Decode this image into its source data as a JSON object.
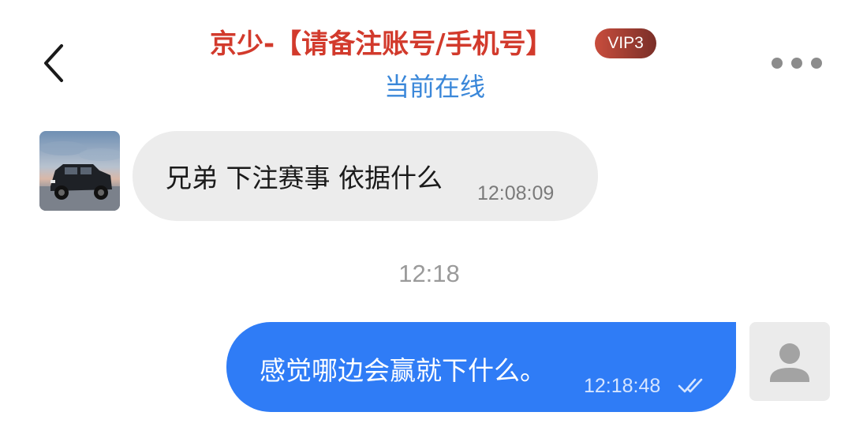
{
  "header": {
    "title": "京少-【请备注账号/手机号】",
    "vip_badge": "VIP3",
    "status": "当前在线"
  },
  "icons": {
    "back": "back-chevron-icon",
    "more": "more-dots-icon",
    "read_receipt": "double-check-icon",
    "default_avatar": "user-silhouette-icon"
  },
  "colors": {
    "title": "#d23a2c",
    "status": "#3a87d9",
    "outgoing_bubble": "#2f7cf6",
    "incoming_bubble": "#ececec",
    "vip_badge_start": "#c84d3d",
    "vip_badge_end": "#7a2f28"
  },
  "messages": [
    {
      "direction": "incoming",
      "text": "兄弟 下注赛事 依据什么",
      "time": "12:08:09"
    },
    {
      "direction": "divider",
      "text": "12:18"
    },
    {
      "direction": "outgoing",
      "text": "感觉哪边会赢就下什么。",
      "time": "12:18:48",
      "read": true
    }
  ]
}
